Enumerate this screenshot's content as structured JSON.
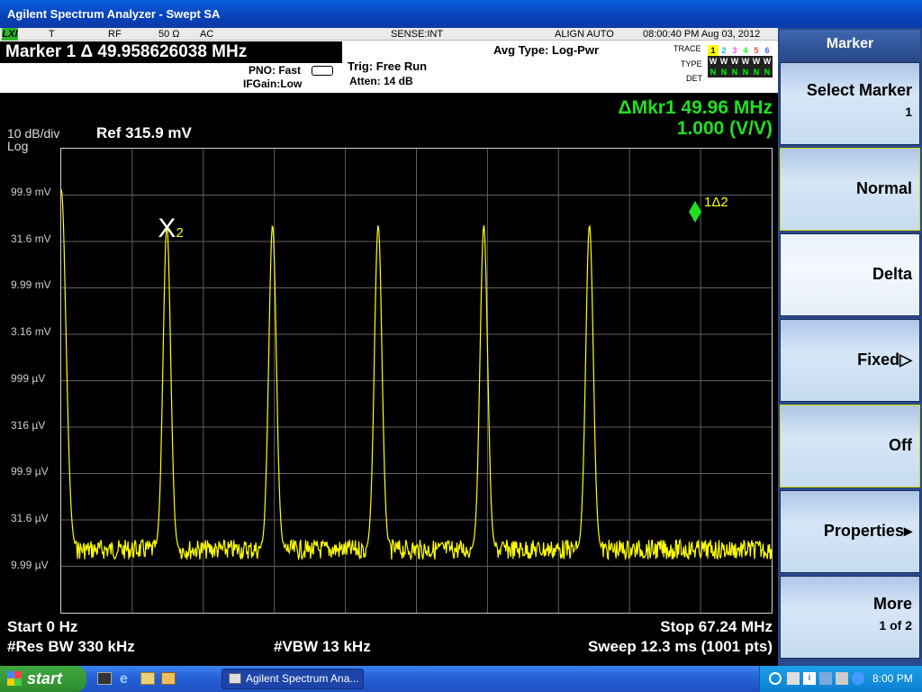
{
  "window": {
    "title": "Agilent Spectrum Analyzer - Swept SA"
  },
  "status_bar": {
    "lxi": "LXI",
    "t": "T",
    "rf": "RF",
    "impedance": "50 Ω",
    "coupling": "AC",
    "sense": "SENSE:INT",
    "align": "ALIGN AUTO",
    "datetime": "08:00:40 PM Aug 03, 2012"
  },
  "header": {
    "marker_readout": "Marker 1 Δ 49.958626038 MHz",
    "pno": "PNO: Fast",
    "ifgain": "IFGain:Low",
    "trig": "Trig: Free Run",
    "atten": "Atten: 14 dB",
    "avg_type": "Avg Type: Log-Pwr",
    "trace_label": "TRACE",
    "type_label": "TYPE",
    "det_label": "DET",
    "trace_nums": [
      "1",
      "2",
      "3",
      "4",
      "5",
      "6"
    ],
    "type_vals": [
      "W",
      "W",
      "W",
      "W",
      "W",
      "W"
    ],
    "det_vals": [
      "N",
      "N",
      "N",
      "N",
      "N",
      "N"
    ],
    "trace_colors": [
      "#ffff00",
      "#00c0ff",
      "#ff40ff",
      "#00ff00",
      "#ff4040",
      "#4060ff"
    ]
  },
  "display": {
    "scale": "10 dB/div",
    "scale_type": "Log",
    "ref": "Ref 315.9 mV",
    "delta_marker_freq": "ΔMkr1 49.96 MHz",
    "delta_marker_ratio": "1.000 (V/V)",
    "start": "Start 0 Hz",
    "stop": "Stop 67.24 MHz",
    "rbw": "#Res BW 330 kHz",
    "vbw": "#VBW 13 kHz",
    "sweep": "Sweep  12.3 ms (1001 pts)",
    "marker_ref_label": "X",
    "marker_ref_sub": "2",
    "marker_delta_label": "1Δ2",
    "trace_color": "#ffff00",
    "readout_green": "#20e020"
  },
  "chart_data": {
    "type": "line",
    "xlim": [
      0,
      67.24
    ],
    "y_tick_labels": [
      "99.9 mV",
      "31.6 mV",
      "9.99 mV",
      "3.16 mV",
      "999 µV",
      "316 µV",
      "99.9 µV",
      "31.6 µV",
      "9.99 µV"
    ],
    "peaks_mhz": [
      0,
      10,
      20,
      30,
      40,
      50
    ],
    "noise_floor_label": "≈ 9.99–31.6 µV"
  },
  "softkeys": {
    "title": "Marker",
    "keys": [
      {
        "label": "Select Marker",
        "sub": "1"
      },
      {
        "label": "Normal",
        "sub": ""
      },
      {
        "label": "Delta",
        "sub": ""
      },
      {
        "label": "Fixed▷",
        "sub": ""
      },
      {
        "label": "Off",
        "sub": ""
      },
      {
        "label": "Properties▸",
        "sub": ""
      },
      {
        "label": "More",
        "sub": "1 of 2"
      }
    ]
  },
  "taskbar": {
    "start": "start",
    "task": "Agilent Spectrum Ana...",
    "time": "8:00 PM"
  }
}
